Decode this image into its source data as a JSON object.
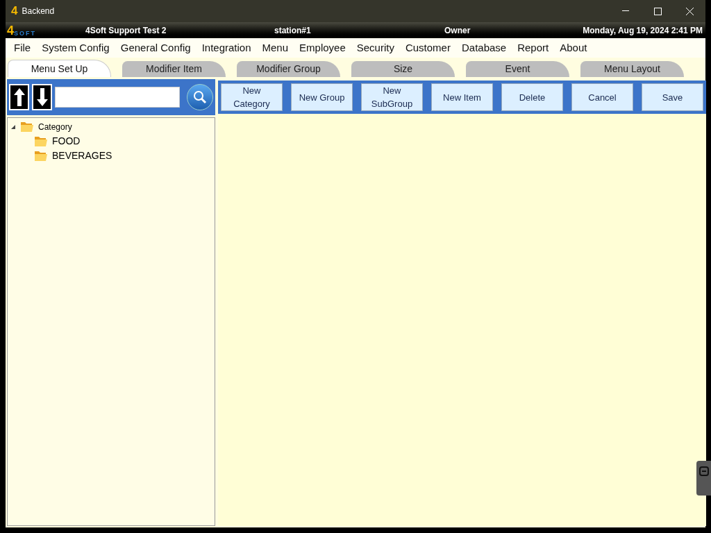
{
  "window": {
    "icon": "4",
    "title": "Backend"
  },
  "header": {
    "logo_mark": "4",
    "logo_word": "SOFT",
    "store": "4Soft Support Test 2",
    "station": "station#1",
    "user": "Owner",
    "datetime": "Monday, Aug 19, 2024 2:41 PM"
  },
  "menu": [
    "File",
    "System Config",
    "General Config",
    "Integration",
    "Menu",
    "Employee",
    "Security",
    "Customer",
    "Database",
    "Report",
    "About"
  ],
  "tabs": [
    {
      "label": "Menu Set Up",
      "selected": true
    },
    {
      "label": "Modifier Item",
      "selected": false
    },
    {
      "label": "Modifier Group",
      "selected": false
    },
    {
      "label": "Size",
      "selected": false
    },
    {
      "label": "Event",
      "selected": false
    },
    {
      "label": "Menu Layout",
      "selected": false
    }
  ],
  "tree": [
    {
      "label": "Category",
      "expanded": true,
      "children": [
        {
          "label": "FOOD"
        },
        {
          "label": "BEVERAGES"
        }
      ]
    }
  ],
  "toolbar": [
    "New Category",
    "New Group",
    "New SubGroup",
    "New Item",
    "Delete",
    "Cancel",
    "Save"
  ]
}
